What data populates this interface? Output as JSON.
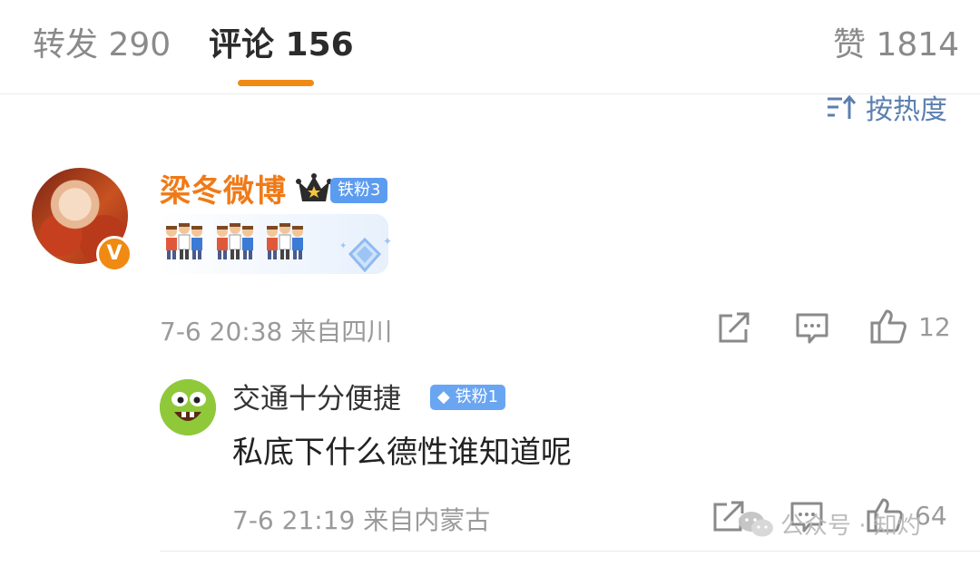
{
  "tabs": {
    "repost": "转发 290",
    "comments": "评论 156",
    "likes": "赞 1814"
  },
  "sort": {
    "label": "按热度"
  },
  "comment": {
    "username": "梁冬微博",
    "fan_badge": "铁粉3",
    "verified_mark": "V",
    "meta": "7-6 20:38 来自四川",
    "like_count": "12"
  },
  "reply": {
    "username": "交通十分便捷",
    "fan_badge": "铁粉1",
    "text": "私底下什么德性谁知道呢",
    "meta": "7-6 21:19 来自内蒙古",
    "like_count": "64"
  },
  "watermark": {
    "text": "公众号 · 知灼"
  },
  "colors": {
    "accent_orange": "#f18a15",
    "username_orange": "#f07a17",
    "badge_blue": "#5c9cf0",
    "sort_blue": "#5b7fb0"
  }
}
